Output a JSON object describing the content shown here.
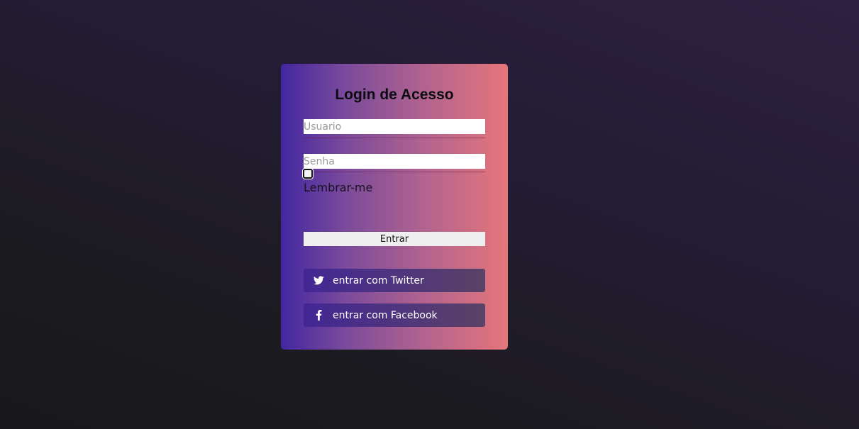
{
  "login": {
    "title": "Login de Acesso",
    "username": {
      "placeholder": "Usuario",
      "value": ""
    },
    "password": {
      "placeholder": "Senha",
      "value": ""
    },
    "remember_label": "Lembrar-me",
    "remember_checked": false,
    "submit_label": "Entrar",
    "twitter_label": "entrar com Twitter",
    "facebook_label": "entrar com Facebook"
  },
  "icons": {
    "twitter": "twitter-icon",
    "facebook": "facebook-icon"
  },
  "colors": {
    "card_gradient_start": "#4227a0",
    "card_gradient_end": "#e5767a",
    "background": "#1c1b20"
  }
}
